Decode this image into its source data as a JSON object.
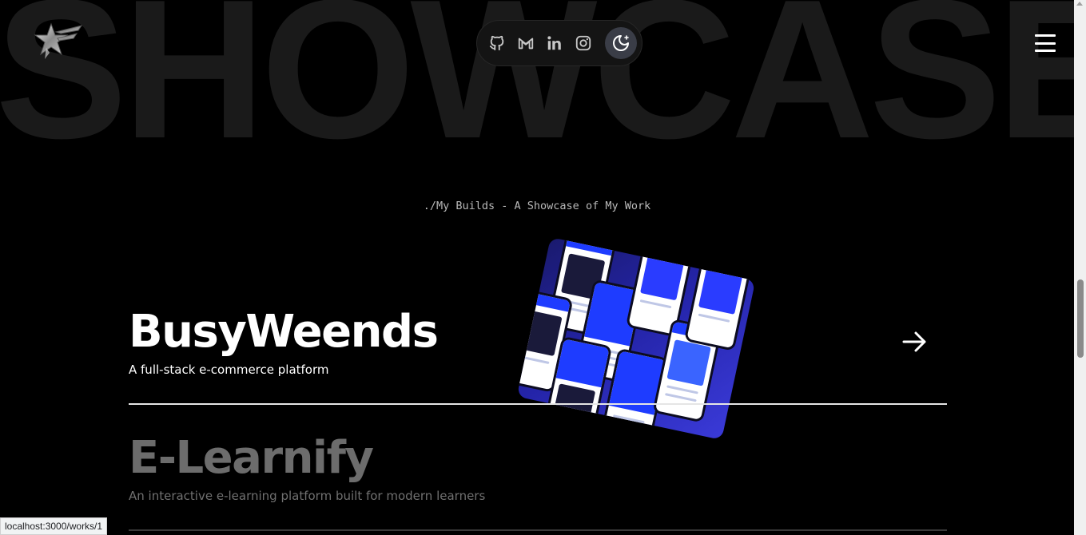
{
  "background_word": "SHOWCASE",
  "brand": {
    "logo_icon": "star-logo-icon"
  },
  "social": [
    {
      "name": "github",
      "icon": "github-icon"
    },
    {
      "name": "gmail",
      "icon": "gmail-icon"
    },
    {
      "name": "linkedin",
      "icon": "linkedin-icon"
    },
    {
      "name": "instagram",
      "icon": "instagram-icon"
    }
  ],
  "theme_toggle": {
    "icon": "moon-icon"
  },
  "menu": {
    "icon": "hamburger-menu-icon"
  },
  "section": {
    "subtitle": "./My Builds - A Showcase of My Work"
  },
  "projects": [
    {
      "title": "BusyWeends",
      "description": "A full-stack e-commerce platform"
    },
    {
      "title": "E-Learnify",
      "description": "An interactive e-learning platform built for modern learners"
    }
  ],
  "status_bar": {
    "url": "localhost:3000/works/1"
  },
  "colors": {
    "background": "#000000",
    "bg_word": "#1a1a1a",
    "preview_blue": "#2424a8"
  }
}
